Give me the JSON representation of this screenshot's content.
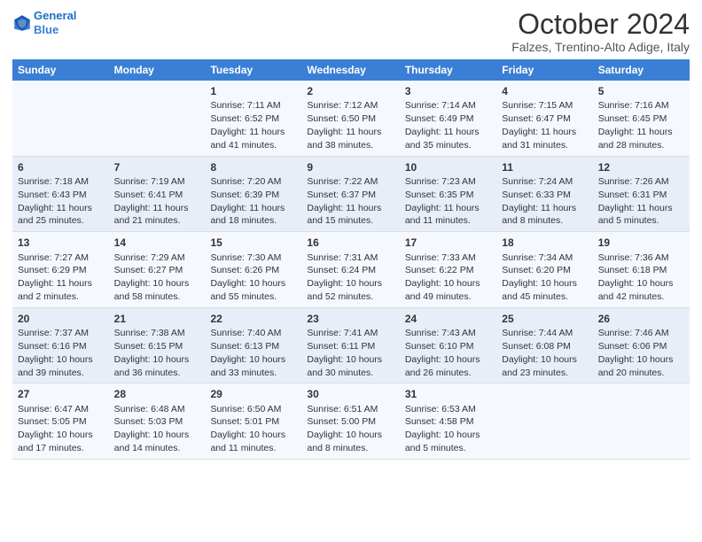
{
  "header": {
    "logo_line1": "General",
    "logo_line2": "Blue",
    "month": "October 2024",
    "location": "Falzes, Trentino-Alto Adige, Italy"
  },
  "weekdays": [
    "Sunday",
    "Monday",
    "Tuesday",
    "Wednesday",
    "Thursday",
    "Friday",
    "Saturday"
  ],
  "weeks": [
    [
      {
        "day": "",
        "sunrise": "",
        "sunset": "",
        "daylight": ""
      },
      {
        "day": "",
        "sunrise": "",
        "sunset": "",
        "daylight": ""
      },
      {
        "day": "1",
        "sunrise": "Sunrise: 7:11 AM",
        "sunset": "Sunset: 6:52 PM",
        "daylight": "Daylight: 11 hours and 41 minutes."
      },
      {
        "day": "2",
        "sunrise": "Sunrise: 7:12 AM",
        "sunset": "Sunset: 6:50 PM",
        "daylight": "Daylight: 11 hours and 38 minutes."
      },
      {
        "day": "3",
        "sunrise": "Sunrise: 7:14 AM",
        "sunset": "Sunset: 6:49 PM",
        "daylight": "Daylight: 11 hours and 35 minutes."
      },
      {
        "day": "4",
        "sunrise": "Sunrise: 7:15 AM",
        "sunset": "Sunset: 6:47 PM",
        "daylight": "Daylight: 11 hours and 31 minutes."
      },
      {
        "day": "5",
        "sunrise": "Sunrise: 7:16 AM",
        "sunset": "Sunset: 6:45 PM",
        "daylight": "Daylight: 11 hours and 28 minutes."
      }
    ],
    [
      {
        "day": "6",
        "sunrise": "Sunrise: 7:18 AM",
        "sunset": "Sunset: 6:43 PM",
        "daylight": "Daylight: 11 hours and 25 minutes."
      },
      {
        "day": "7",
        "sunrise": "Sunrise: 7:19 AM",
        "sunset": "Sunset: 6:41 PM",
        "daylight": "Daylight: 11 hours and 21 minutes."
      },
      {
        "day": "8",
        "sunrise": "Sunrise: 7:20 AM",
        "sunset": "Sunset: 6:39 PM",
        "daylight": "Daylight: 11 hours and 18 minutes."
      },
      {
        "day": "9",
        "sunrise": "Sunrise: 7:22 AM",
        "sunset": "Sunset: 6:37 PM",
        "daylight": "Daylight: 11 hours and 15 minutes."
      },
      {
        "day": "10",
        "sunrise": "Sunrise: 7:23 AM",
        "sunset": "Sunset: 6:35 PM",
        "daylight": "Daylight: 11 hours and 11 minutes."
      },
      {
        "day": "11",
        "sunrise": "Sunrise: 7:24 AM",
        "sunset": "Sunset: 6:33 PM",
        "daylight": "Daylight: 11 hours and 8 minutes."
      },
      {
        "day": "12",
        "sunrise": "Sunrise: 7:26 AM",
        "sunset": "Sunset: 6:31 PM",
        "daylight": "Daylight: 11 hours and 5 minutes."
      }
    ],
    [
      {
        "day": "13",
        "sunrise": "Sunrise: 7:27 AM",
        "sunset": "Sunset: 6:29 PM",
        "daylight": "Daylight: 11 hours and 2 minutes."
      },
      {
        "day": "14",
        "sunrise": "Sunrise: 7:29 AM",
        "sunset": "Sunset: 6:27 PM",
        "daylight": "Daylight: 10 hours and 58 minutes."
      },
      {
        "day": "15",
        "sunrise": "Sunrise: 7:30 AM",
        "sunset": "Sunset: 6:26 PM",
        "daylight": "Daylight: 10 hours and 55 minutes."
      },
      {
        "day": "16",
        "sunrise": "Sunrise: 7:31 AM",
        "sunset": "Sunset: 6:24 PM",
        "daylight": "Daylight: 10 hours and 52 minutes."
      },
      {
        "day": "17",
        "sunrise": "Sunrise: 7:33 AM",
        "sunset": "Sunset: 6:22 PM",
        "daylight": "Daylight: 10 hours and 49 minutes."
      },
      {
        "day": "18",
        "sunrise": "Sunrise: 7:34 AM",
        "sunset": "Sunset: 6:20 PM",
        "daylight": "Daylight: 10 hours and 45 minutes."
      },
      {
        "day": "19",
        "sunrise": "Sunrise: 7:36 AM",
        "sunset": "Sunset: 6:18 PM",
        "daylight": "Daylight: 10 hours and 42 minutes."
      }
    ],
    [
      {
        "day": "20",
        "sunrise": "Sunrise: 7:37 AM",
        "sunset": "Sunset: 6:16 PM",
        "daylight": "Daylight: 10 hours and 39 minutes."
      },
      {
        "day": "21",
        "sunrise": "Sunrise: 7:38 AM",
        "sunset": "Sunset: 6:15 PM",
        "daylight": "Daylight: 10 hours and 36 minutes."
      },
      {
        "day": "22",
        "sunrise": "Sunrise: 7:40 AM",
        "sunset": "Sunset: 6:13 PM",
        "daylight": "Daylight: 10 hours and 33 minutes."
      },
      {
        "day": "23",
        "sunrise": "Sunrise: 7:41 AM",
        "sunset": "Sunset: 6:11 PM",
        "daylight": "Daylight: 10 hours and 30 minutes."
      },
      {
        "day": "24",
        "sunrise": "Sunrise: 7:43 AM",
        "sunset": "Sunset: 6:10 PM",
        "daylight": "Daylight: 10 hours and 26 minutes."
      },
      {
        "day": "25",
        "sunrise": "Sunrise: 7:44 AM",
        "sunset": "Sunset: 6:08 PM",
        "daylight": "Daylight: 10 hours and 23 minutes."
      },
      {
        "day": "26",
        "sunrise": "Sunrise: 7:46 AM",
        "sunset": "Sunset: 6:06 PM",
        "daylight": "Daylight: 10 hours and 20 minutes."
      }
    ],
    [
      {
        "day": "27",
        "sunrise": "Sunrise: 6:47 AM",
        "sunset": "Sunset: 5:05 PM",
        "daylight": "Daylight: 10 hours and 17 minutes."
      },
      {
        "day": "28",
        "sunrise": "Sunrise: 6:48 AM",
        "sunset": "Sunset: 5:03 PM",
        "daylight": "Daylight: 10 hours and 14 minutes."
      },
      {
        "day": "29",
        "sunrise": "Sunrise: 6:50 AM",
        "sunset": "Sunset: 5:01 PM",
        "daylight": "Daylight: 10 hours and 11 minutes."
      },
      {
        "day": "30",
        "sunrise": "Sunrise: 6:51 AM",
        "sunset": "Sunset: 5:00 PM",
        "daylight": "Daylight: 10 hours and 8 minutes."
      },
      {
        "day": "31",
        "sunrise": "Sunrise: 6:53 AM",
        "sunset": "Sunset: 4:58 PM",
        "daylight": "Daylight: 10 hours and 5 minutes."
      },
      {
        "day": "",
        "sunrise": "",
        "sunset": "",
        "daylight": ""
      },
      {
        "day": "",
        "sunrise": "",
        "sunset": "",
        "daylight": ""
      }
    ]
  ]
}
